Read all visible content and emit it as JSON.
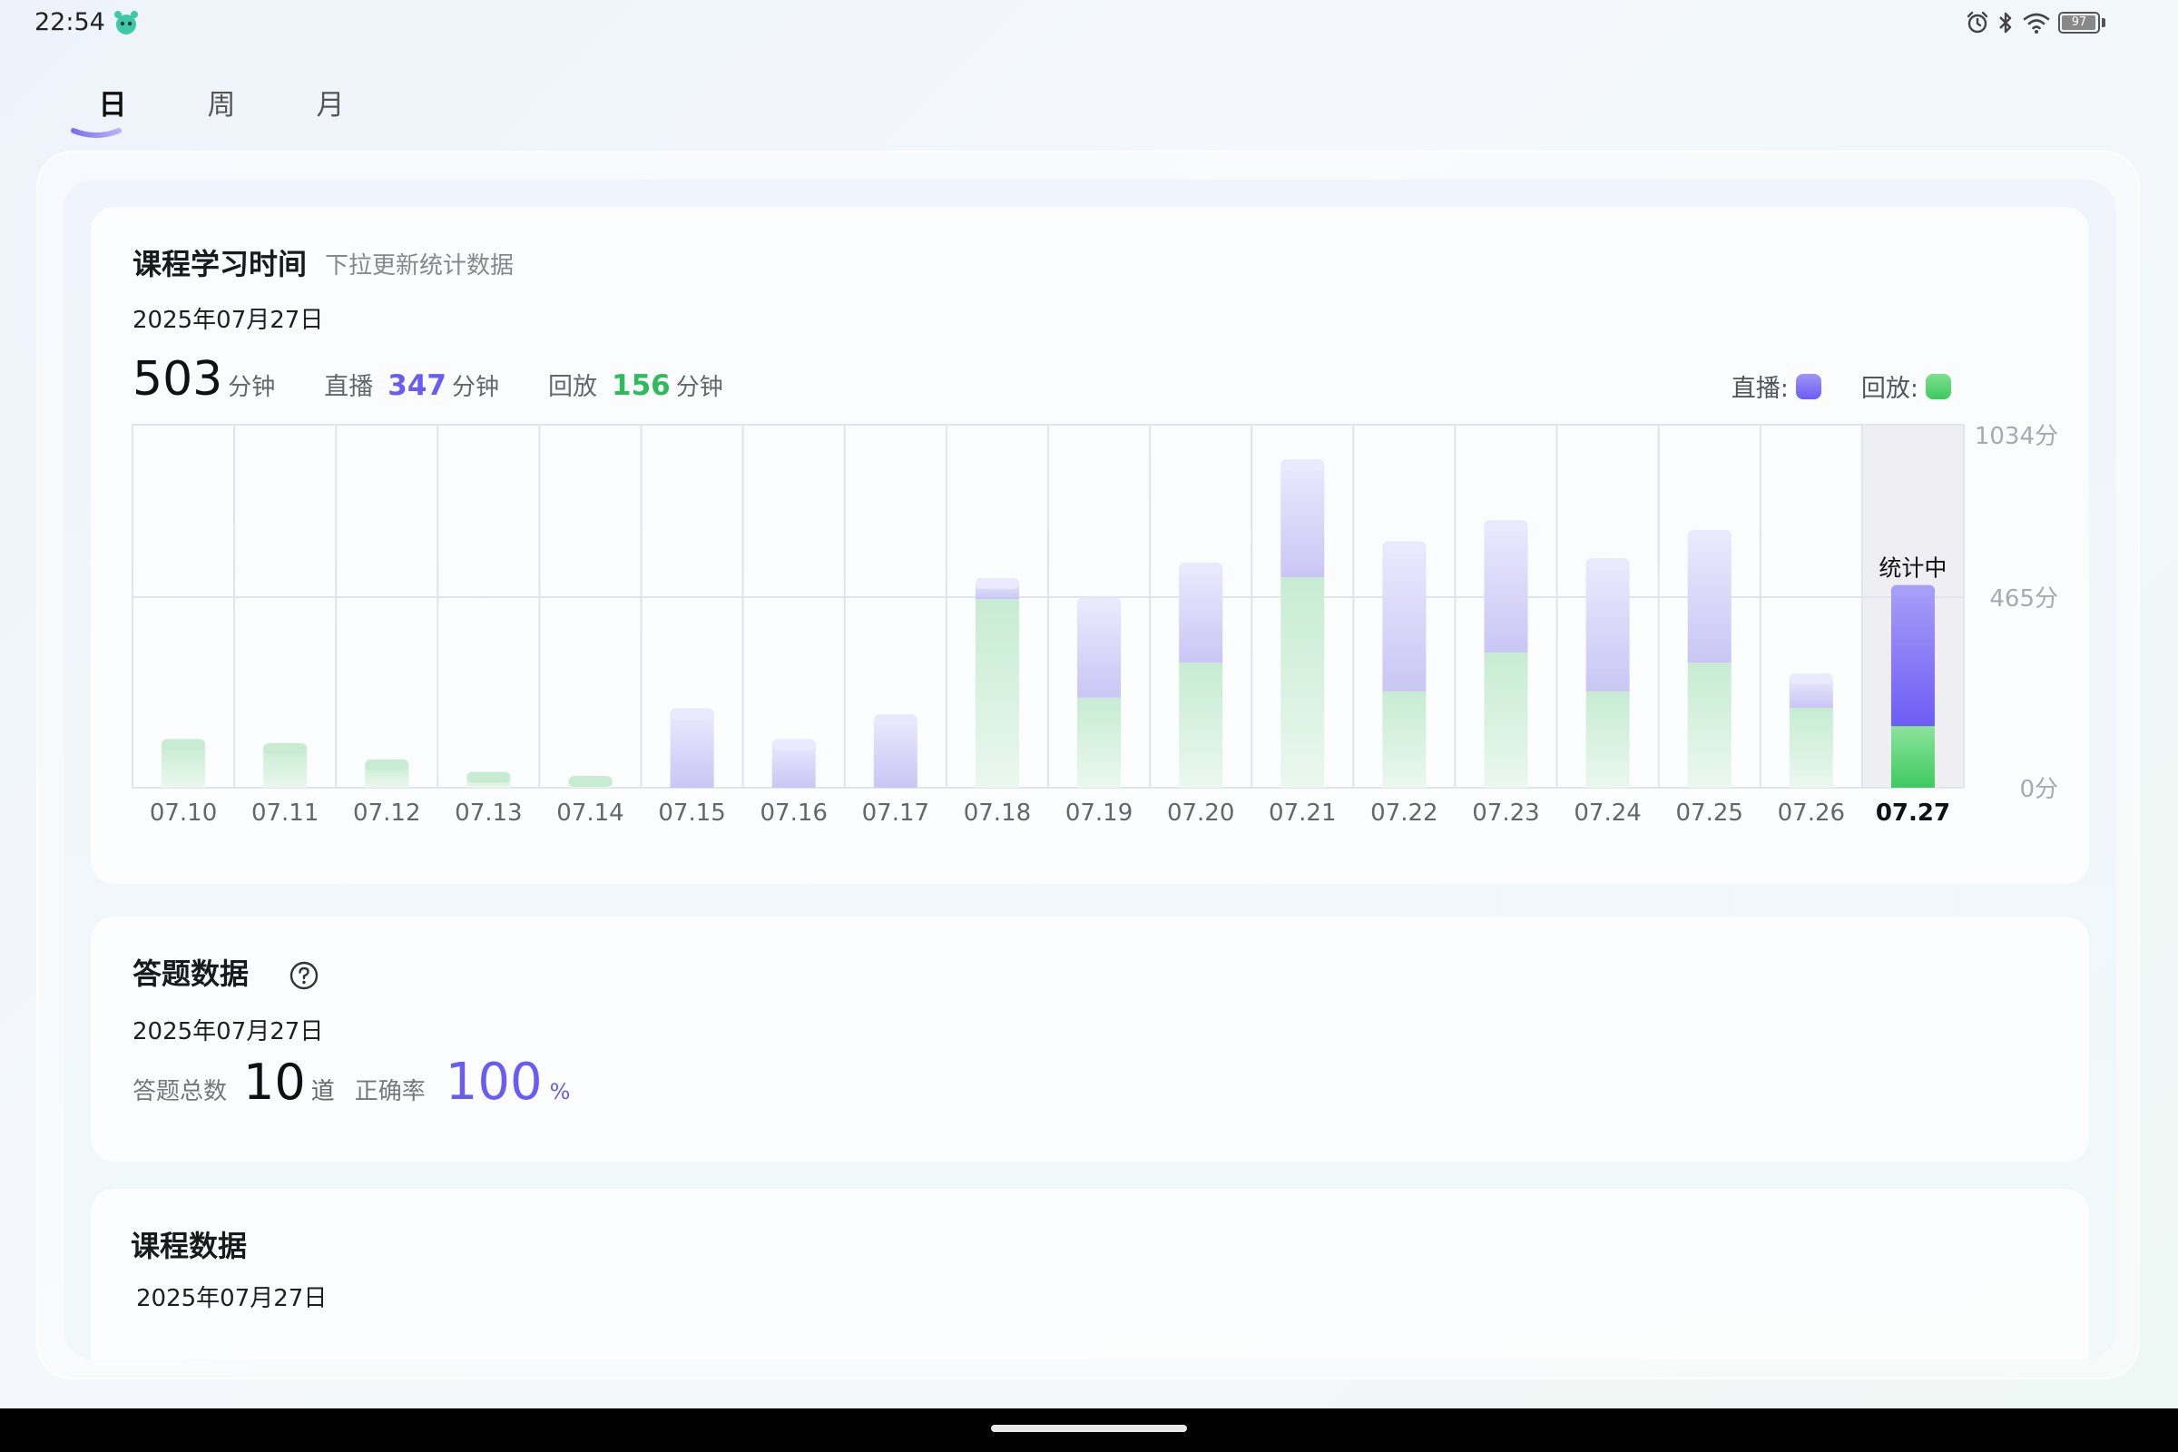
{
  "status_bar": {
    "time": "22:54",
    "app_icon": "app-mascot-icon",
    "icons": [
      "alarm-icon",
      "bluetooth-icon",
      "wifi-icon",
      "battery-icon"
    ],
    "battery_level": "97"
  },
  "tabs": [
    {
      "label": "日",
      "active": true
    },
    {
      "label": "周",
      "active": false
    },
    {
      "label": "月",
      "active": false
    }
  ],
  "colors": {
    "accent_purple": "#6a5cf0",
    "accent_green": "#2fbb5b",
    "live_bar": "#c9c6f5",
    "replay_bar": "#c7ecd2",
    "live_bar_selected": "#6d5cf5",
    "replay_bar_selected": "#3fc960"
  },
  "study_time": {
    "title": "课程学习时间",
    "subtitle": "下拉更新统计数据",
    "date": "2025年07月27日",
    "total_value": "503",
    "total_unit": "分钟",
    "live_label": "直播",
    "live_value": "347",
    "live_unit": "分钟",
    "replay_label": "回放",
    "replay_value": "156",
    "replay_unit": "分钟",
    "legend_live": "直播:",
    "legend_replay": "回放:"
  },
  "chart_data": {
    "type": "bar",
    "stacked": true,
    "categories": [
      "07.10",
      "07.11",
      "07.12",
      "07.13",
      "07.14",
      "07.15",
      "07.16",
      "07.17",
      "07.18",
      "07.19",
      "07.20",
      "07.21",
      "07.22",
      "07.23",
      "07.24",
      "07.25",
      "07.26",
      "07.27"
    ],
    "series": [
      {
        "name": "回放",
        "values": [
          110,
          100,
          60,
          30,
          20,
          0,
          0,
          0,
          460,
          220,
          305,
          535,
          235,
          330,
          235,
          305,
          195,
          150
        ]
      },
      {
        "name": "直播",
        "values": [
          0,
          0,
          0,
          0,
          0,
          185,
          110,
          170,
          60,
          235,
          270,
          405,
          415,
          395,
          355,
          385,
          75,
          345
        ]
      }
    ],
    "y_ticks": [
      "1034分",
      "465分",
      "0分"
    ],
    "y_tick_values": [
      1034,
      465,
      0
    ],
    "ylim": [
      0,
      1034
    ],
    "selected_category": "07.27",
    "selected_annotation": "统计中",
    "grid": true
  },
  "answers": {
    "title": "答题数据",
    "help_icon": "question-circle-icon",
    "date": "2025年07月27日",
    "total_label": "答题总数",
    "total_value": "10",
    "total_unit": "道",
    "rate_label": "正确率",
    "rate_value": "100",
    "rate_unit": "%"
  },
  "course": {
    "title": "课程数据",
    "date": "2025年07月27日"
  }
}
